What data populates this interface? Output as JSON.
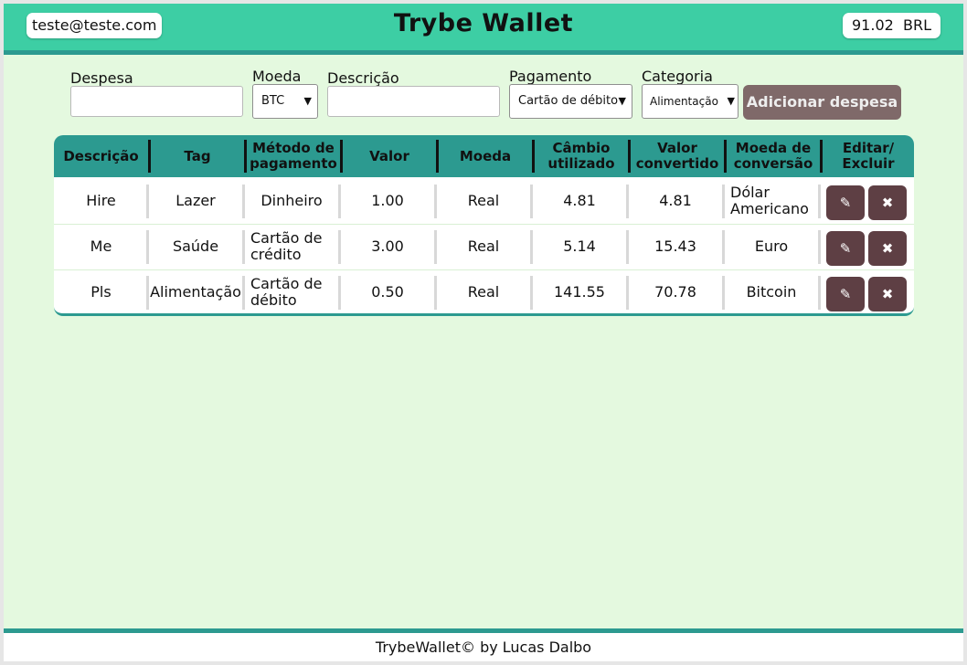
{
  "header": {
    "email": "teste@teste.com",
    "title": "Trybe Wallet",
    "total": "91.02",
    "currency": "BRL"
  },
  "form": {
    "expense_label": "Despesa",
    "expense_value": "",
    "currency_label": "Moeda",
    "currency_value": "BTC",
    "description_label": "Descrição",
    "description_value": "",
    "payment_label": "Pagamento",
    "payment_value": "Cartão de débito",
    "category_label": "Categoria",
    "category_value": "Alimentação",
    "add_button": "Adicionar despesa"
  },
  "table": {
    "headers": {
      "description": "Descrição",
      "tag": "Tag",
      "method_1": "Método de",
      "method_2": "pagamento",
      "value": "Valor",
      "currency": "Moeda",
      "rate_1": "Câmbio",
      "rate_2": "utilizado",
      "converted_1": "Valor",
      "converted_2": "convertido",
      "conv_currency_1": "Moeda de",
      "conv_currency_2": "conversão",
      "actions_1": "Editar/",
      "actions_2": "Excluir"
    },
    "rows": [
      {
        "description": "Hire",
        "tag": "Lazer",
        "method_1": "Dinheiro",
        "method_2": "",
        "value": "1.00",
        "currency": "Real",
        "rate": "4.81",
        "converted": "4.81",
        "conv_1": "Dólar",
        "conv_2": "Americano"
      },
      {
        "description": "Me",
        "tag": "Saúde",
        "method_1": "Cartão de",
        "method_2": "crédito",
        "value": "3.00",
        "currency": "Real",
        "rate": "5.14",
        "converted": "15.43",
        "conv_1": "Euro",
        "conv_2": ""
      },
      {
        "description": "Pls",
        "tag": "Alimentação",
        "method_1": "Cartão de",
        "method_2": "débito",
        "value": "0.50",
        "currency": "Real",
        "rate": "141.55",
        "converted": "70.78",
        "conv_1": "Bitcoin",
        "conv_2": ""
      }
    ],
    "edit_glyph": "✎",
    "delete_glyph": "✖"
  },
  "footer": {
    "text": "TrybeWallet© by Lucas Dalbo"
  },
  "colors": {
    "header_bg": "#3dcea4",
    "accent": "#2c9a90",
    "page_bg": "#e4f9df",
    "button_bg": "#7f6969",
    "action_bg": "#5e3f44"
  }
}
